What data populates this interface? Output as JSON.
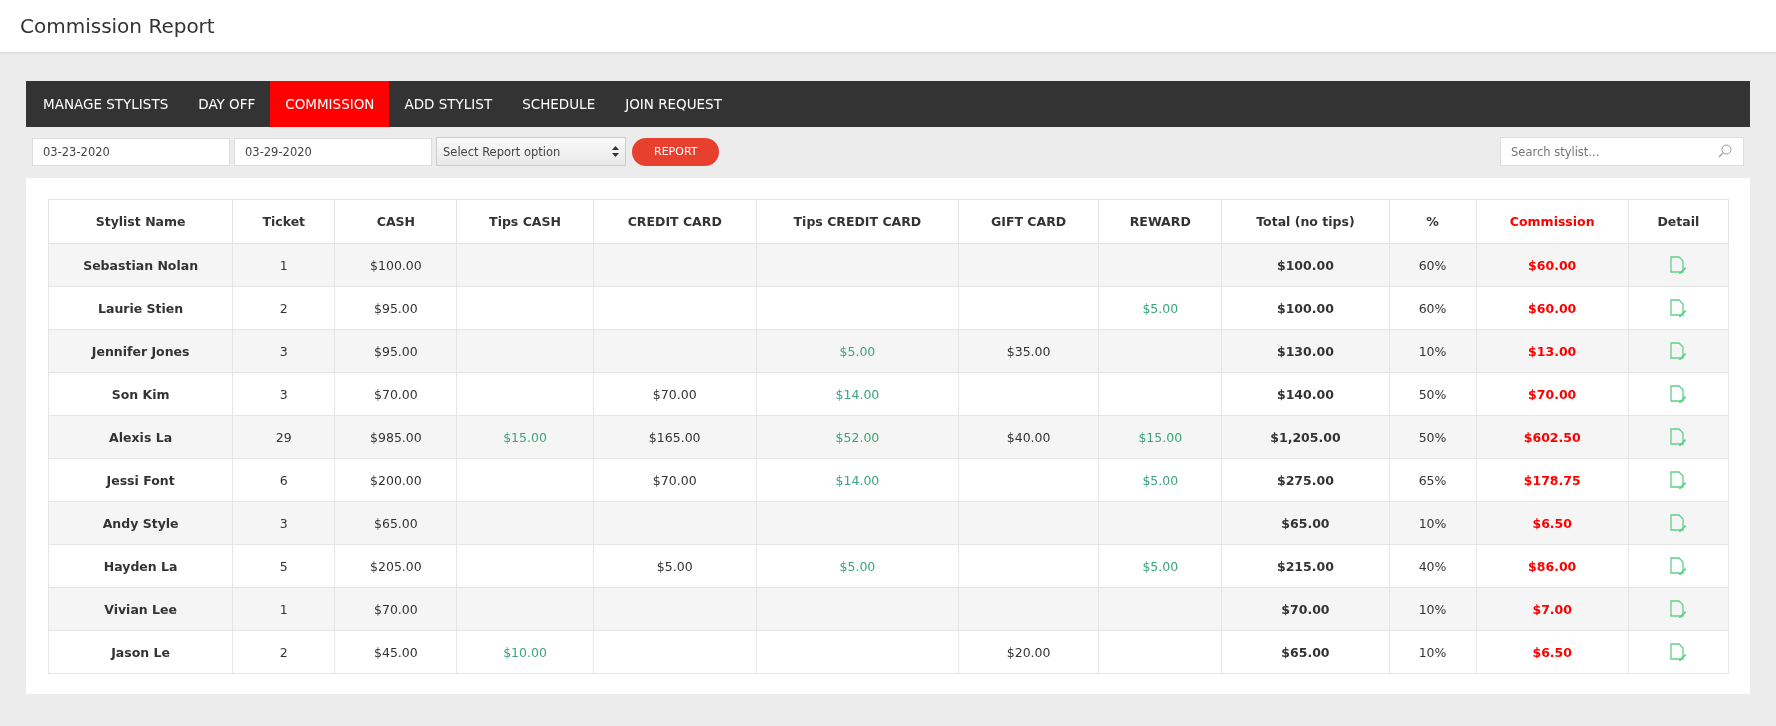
{
  "page_title": "Commission Report",
  "tabs": [
    {
      "label": "MANAGE STYLISTS",
      "selected": false
    },
    {
      "label": "DAY OFF",
      "selected": false
    },
    {
      "label": "COMMISSION",
      "selected": true
    },
    {
      "label": "ADD STYLIST",
      "selected": false
    },
    {
      "label": "SCHEDULE",
      "selected": false
    },
    {
      "label": "JOIN REQUEST",
      "selected": false
    }
  ],
  "filters": {
    "start_date": "03-23-2020",
    "end_date": "03-29-2020",
    "report_option": "Select Report option",
    "report_button": "REPORT",
    "search": {
      "placeholder": "Search stylist..."
    }
  },
  "table": {
    "columns": [
      {
        "label": "Stylist Name",
        "kind": "name"
      },
      {
        "label": "Ticket",
        "kind": "plain"
      },
      {
        "label": "CASH",
        "kind": "plain"
      },
      {
        "label": "Tips CASH",
        "kind": "tip"
      },
      {
        "label": "CREDIT CARD",
        "kind": "plain"
      },
      {
        "label": "Tips CREDIT CARD",
        "kind": "tip"
      },
      {
        "label": "GIFT CARD",
        "kind": "plain"
      },
      {
        "label": "REWARD",
        "kind": "tip"
      },
      {
        "label": "Total (no tips)",
        "kind": "total"
      },
      {
        "label": "%",
        "kind": "plain"
      },
      {
        "label": "Commission",
        "kind": "commission"
      },
      {
        "label": "Detail",
        "kind": "detail"
      }
    ],
    "rows": [
      [
        "Sebastian Nolan",
        "1",
        "$100.00",
        null,
        null,
        null,
        null,
        null,
        "$100.00",
        "60%",
        "$60.00"
      ],
      [
        "Laurie Stien",
        "2",
        "$95.00",
        null,
        null,
        null,
        null,
        "$5.00",
        "$100.00",
        "60%",
        "$60.00"
      ],
      [
        "Jennifer Jones",
        "3",
        "$95.00",
        null,
        null,
        "$5.00",
        "$35.00",
        null,
        "$130.00",
        "10%",
        "$13.00"
      ],
      [
        "Son Kim",
        "3",
        "$70.00",
        null,
        "$70.00",
        "$14.00",
        null,
        null,
        "$140.00",
        "50%",
        "$70.00"
      ],
      [
        "Alexis La",
        "29",
        "$985.00",
        "$15.00",
        "$165.00",
        "$52.00",
        "$40.00",
        "$15.00",
        "$1,205.00",
        "50%",
        "$602.50"
      ],
      [
        "Jessi Font",
        "6",
        "$200.00",
        null,
        "$70.00",
        "$14.00",
        null,
        "$5.00",
        "$275.00",
        "65%",
        "$178.75"
      ],
      [
        "Andy Style",
        "3",
        "$65.00",
        null,
        null,
        null,
        null,
        null,
        "$65.00",
        "10%",
        "$6.50"
      ],
      [
        "Hayden La",
        "5",
        "$205.00",
        null,
        "$5.00",
        "$5.00",
        null,
        "$5.00",
        "$215.00",
        "40%",
        "$86.00"
      ],
      [
        "Vivian Lee",
        "1",
        "$70.00",
        null,
        null,
        null,
        null,
        null,
        "$70.00",
        "10%",
        "$7.00"
      ],
      [
        "Jason Le",
        "2",
        "$45.00",
        "$10.00",
        null,
        null,
        "$20.00",
        null,
        "$65.00",
        "10%",
        "$6.50"
      ]
    ]
  }
}
